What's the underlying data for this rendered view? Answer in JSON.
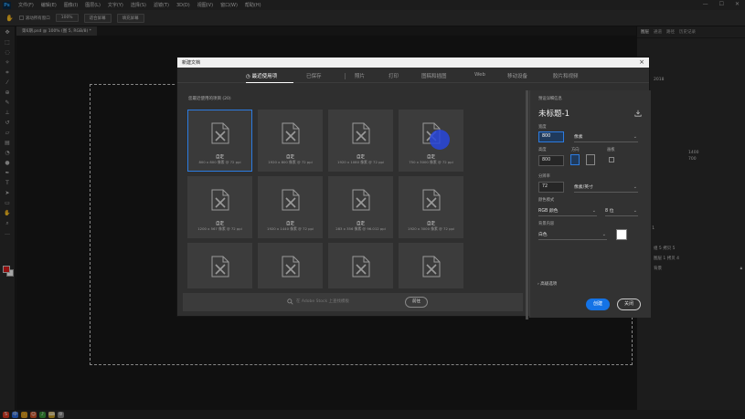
{
  "app": {
    "logo": "Ps"
  },
  "menu": [
    "文件(F)",
    "编辑(E)",
    "图像(I)",
    "图层(L)",
    "文字(Y)",
    "选择(S)",
    "滤镜(T)",
    "3D(D)",
    "视图(V)",
    "窗口(W)",
    "帮助(H)"
  ],
  "options_bar": {
    "scroll_all": "滚动所有窗口",
    "zoom": "100%",
    "fit_screen": "适合屏幕",
    "fill_screen": "填充屏幕"
  },
  "document_tab": "第6期.psd @ 100% (图 5, RGB/8) *",
  "right_panel": {
    "tabs": [
      "图层",
      "通道",
      "路径",
      "历史记录"
    ],
    "layers": [
      {
        "name": "2018",
        "thumb": "white"
      },
      {
        "name": "组 1",
        "thumb": "none"
      },
      {
        "name": "主体",
        "thumb": "none"
      },
      {
        "name": "组 5 拷贝 5",
        "thumb": "white"
      },
      {
        "name": "图层 1 拷贝 4",
        "thumb": "dark"
      },
      {
        "name": "背景",
        "thumb": "dark"
      }
    ],
    "coords": [
      "1400",
      "700"
    ]
  },
  "dialog": {
    "title": "新建文档",
    "tabs": [
      "最近使用项",
      "已保存",
      "照片",
      "打印",
      "图稿和插图",
      "Web",
      "移动设备",
      "胶片和视频"
    ],
    "recent_header": "您最近使用的项目 (20)",
    "cards": [
      {
        "name": "自定",
        "size": "800 x 800 像素 @ 72 ppi",
        "selected": true
      },
      {
        "name": "自定",
        "size": "1920 x 800 像素 @ 72 ppi",
        "selected": false
      },
      {
        "name": "自定",
        "size": "1920 x 1080 像素 @ 72 ppi",
        "selected": false
      },
      {
        "name": "自定",
        "size": "750 x 3000 像素 @ 72 ppi",
        "selected": false
      },
      {
        "name": "自定",
        "size": "1200 x 567 像素 @ 72 ppi",
        "selected": false
      },
      {
        "name": "自定",
        "size": "1920 x 1440 像素 @ 72 ppi",
        "selected": false
      },
      {
        "name": "自定",
        "size": "283 x 356 像素 @ 96.012 ppi",
        "selected": false
      },
      {
        "name": "自定",
        "size": "1920 x 3000 像素 @ 72 ppi",
        "selected": false
      },
      {
        "name": "",
        "size": "",
        "selected": false
      },
      {
        "name": "",
        "size": "",
        "selected": false
      },
      {
        "name": "",
        "size": "",
        "selected": false
      },
      {
        "name": "",
        "size": "",
        "selected": false
      }
    ],
    "search_placeholder": "在 Adobe Stock 上查找模板",
    "go_label": "前往",
    "details": {
      "section_label": "预设详细信息",
      "doc_name": "未标题-1",
      "width_label": "宽度",
      "width": "800",
      "width_unit": "像素",
      "height_label": "高度",
      "height": "800",
      "orientation_label": "方向",
      "artboard_label": "画板",
      "resolution_label": "分辨率",
      "resolution": "72",
      "resolution_unit": "像素/英寸",
      "color_mode_label": "颜色模式",
      "color_mode": "RGB 颜色",
      "bit_depth": "8 位",
      "background_label": "背景内容",
      "background": "白色",
      "advanced": "高级选项"
    },
    "create_label": "创建",
    "close_label": "关闭"
  }
}
